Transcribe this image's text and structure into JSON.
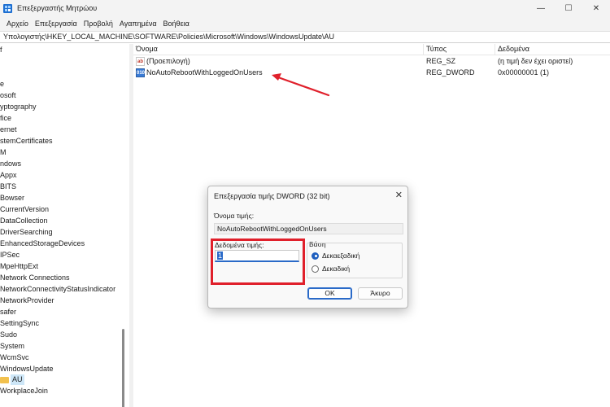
{
  "window": {
    "title": "Επεξεργαστής Μητρώου",
    "controls": [
      "—",
      "☐",
      "✕"
    ]
  },
  "menu": [
    "Αρχείο",
    "Επεξεργασία",
    "Προβολή",
    "Αγαπημένα",
    "Βοήθεια"
  ],
  "address": "Υπολογιστής\\HKEY_LOCAL_MACHINE\\SOFTWARE\\Policies\\Microsoft\\Windows\\WindowsUpdate\\AU",
  "tree": {
    "items": [
      "f",
      "",
      "",
      "e",
      "osoft",
      "yptography",
      "fice",
      "ernet",
      "stemCertificates",
      "M",
      "ndows",
      "Appx",
      "BITS",
      "Bowser",
      "CurrentVersion",
      "DataCollection",
      "DriverSearching",
      "EnhancedStorageDevices",
      "IPSec",
      "MpeHttpExt",
      "Network Connections",
      "NetworkConnectivityStatusIndicator",
      "NetworkProvider",
      "safer",
      "SettingSync",
      "Sudo",
      "System",
      "WcmSvc",
      "WindowsUpdate"
    ],
    "selected": "AU",
    "after": [
      "WorkplaceJoin"
    ]
  },
  "list": {
    "headers": {
      "name": "Όνομα",
      "type": "Τύπος",
      "data": "Δεδομένα"
    },
    "rows": [
      {
        "icon": "ab",
        "name": "(Προεπιλογή)",
        "type": "REG_SZ",
        "data": "(η τιμή δεν έχει οριστεί)"
      },
      {
        "icon": "010",
        "name": "NoAutoRebootWithLoggedOnUsers",
        "type": "REG_DWORD",
        "data": "0x00000001 (1)"
      }
    ]
  },
  "dialog": {
    "title": "Επεξεργασία τιμής DWORD (32 bit)",
    "close": "✕",
    "name_label": "Όνομα τιμής:",
    "name_value": "NoAutoRebootWithLoggedOnUsers",
    "data_label": "Δεδομένα τιμής:",
    "data_value": "1",
    "base_label": "Βάση",
    "base_hex": "Δεκαεξαδική",
    "base_dec": "Δεκαδική",
    "ok": "OK",
    "cancel": "Άκυρο"
  },
  "colors": {
    "annotation": "#e0202b",
    "accent": "#2a6ac8"
  }
}
